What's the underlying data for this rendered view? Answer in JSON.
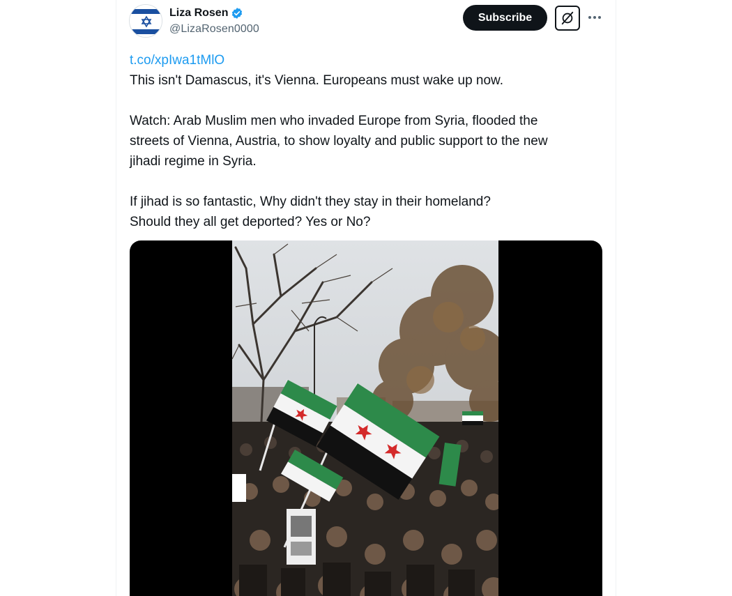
{
  "author": {
    "display_name": "Liza Rosen",
    "handle": "@LizaRosen0000",
    "verified": true,
    "verified_color": "#1d9bf0",
    "avatar_icon": "israel-flag-heart-avatar"
  },
  "actions": {
    "subscribe_label": "Subscribe",
    "grok_icon": "grok-icon",
    "more_icon": "more-horizontal-icon"
  },
  "tweet": {
    "link": "t.co/xpIwa1tMlO",
    "paragraphs": [
      [
        "This isn't Damascus, it's Vienna. Europeans must wake up now."
      ],
      [
        "Watch: Arab Muslim men who invaded Europe from Syria, flooded the",
        "streets of Vienna, Austria, to show loyalty and public support to the new",
        "jihadi regime in Syria."
      ],
      [
        "If jihad is so fantastic, Why didn't they stay in their homeland?",
        "Should they all get deported? Yes or No?"
      ]
    ]
  },
  "media": {
    "type": "video",
    "description_icon": "video-thumbnail"
  },
  "colors": {
    "text_primary": "#0f1419",
    "text_secondary": "#536471",
    "link": "#1d9bf0",
    "button_dark": "#0f1419"
  }
}
